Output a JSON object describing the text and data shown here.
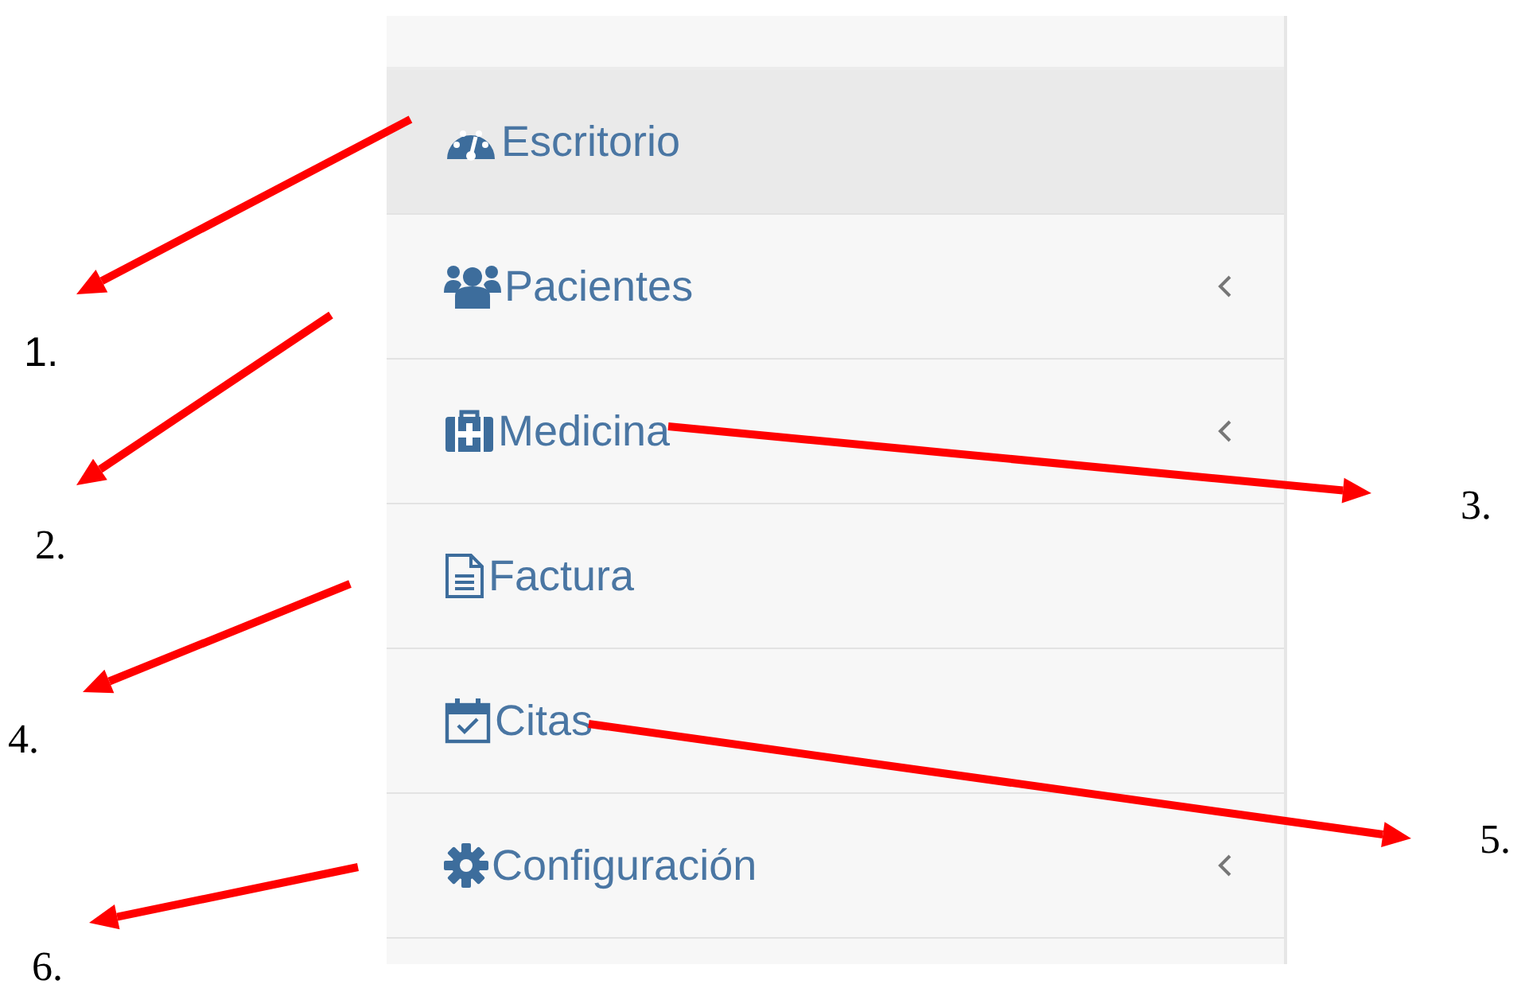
{
  "sidebar": {
    "items": [
      {
        "label": "Escritorio",
        "selected": true,
        "has_submenu": false
      },
      {
        "label": "Pacientes",
        "selected": false,
        "has_submenu": true
      },
      {
        "label": "Medicina",
        "selected": false,
        "has_submenu": true
      },
      {
        "label": "Factura",
        "selected": false,
        "has_submenu": false
      },
      {
        "label": "Citas",
        "selected": false,
        "has_submenu": false
      },
      {
        "label": "Configuración",
        "selected": false,
        "has_submenu": true
      }
    ]
  },
  "annotations": [
    {
      "label": "1."
    },
    {
      "label": "2."
    },
    {
      "label": "3."
    },
    {
      "label": "4."
    },
    {
      "label": "5."
    },
    {
      "label": "6."
    }
  ]
}
